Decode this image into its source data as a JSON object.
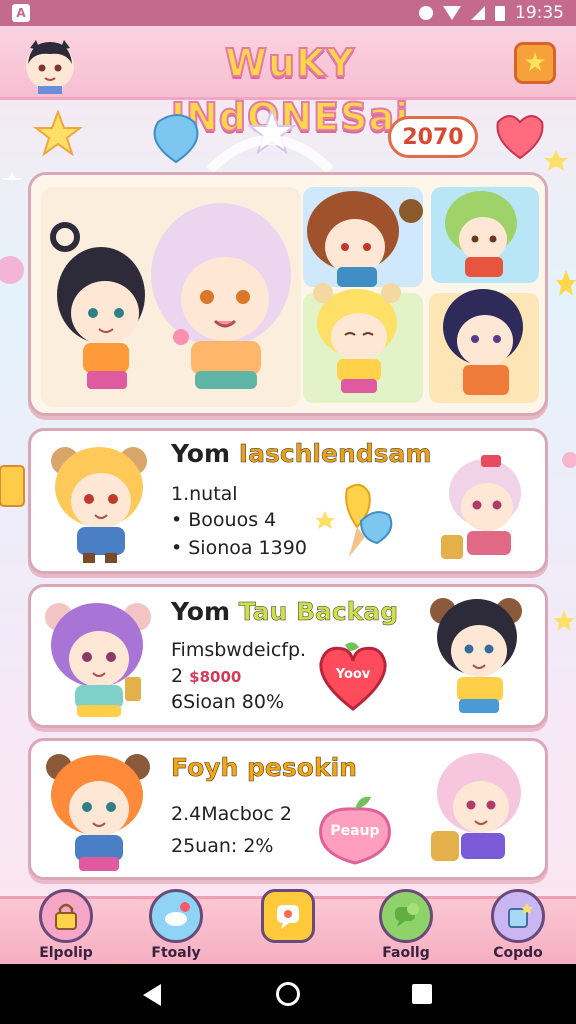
{
  "status_bar": {
    "time": "19:35"
  },
  "header": {
    "title": "WuKY INdONESai"
  },
  "year_badge": "2070",
  "cards": [
    {
      "title_a": "Yom",
      "title_b": "Iaschlendsam",
      "lines": [
        "1.nutal",
        "• Boouos 4",
        "• Sionoa 1390"
      ]
    },
    {
      "title_a": "Yom",
      "title_b": "Tau Backag",
      "lines": [
        "Fimsbwdeicfp.",
        "2",
        "$8000",
        "6Sioan 80%"
      ]
    },
    {
      "title_a": "Foyh pesokin",
      "title_b": "",
      "lines": [
        "2.4Macboc 2",
        "25uan: 2%"
      ]
    }
  ],
  "stickers": {
    "heart": "Yoov",
    "peach": "Peaup"
  },
  "bottom_nav": {
    "items": [
      {
        "label": "Elpolip",
        "icon": "lock-bag-icon",
        "color": "#f6a7c7"
      },
      {
        "label": "Ftoaly",
        "icon": "cloud-bubble-icon",
        "color": "#8fd3f5"
      },
      {
        "label": "",
        "icon": "chat-bubble-icon",
        "color": "#ffc93c"
      },
      {
        "label": "Faollg",
        "icon": "speech-bubble-icon",
        "color": "#8ed36a"
      },
      {
        "label": "Copdo",
        "icon": "gift-box-icon",
        "color": "#c9b6f2"
      }
    ]
  },
  "colors": {
    "accent": "#e77aa8",
    "title_fill": "#ffd84a",
    "card_border": "#d9a7b6"
  }
}
